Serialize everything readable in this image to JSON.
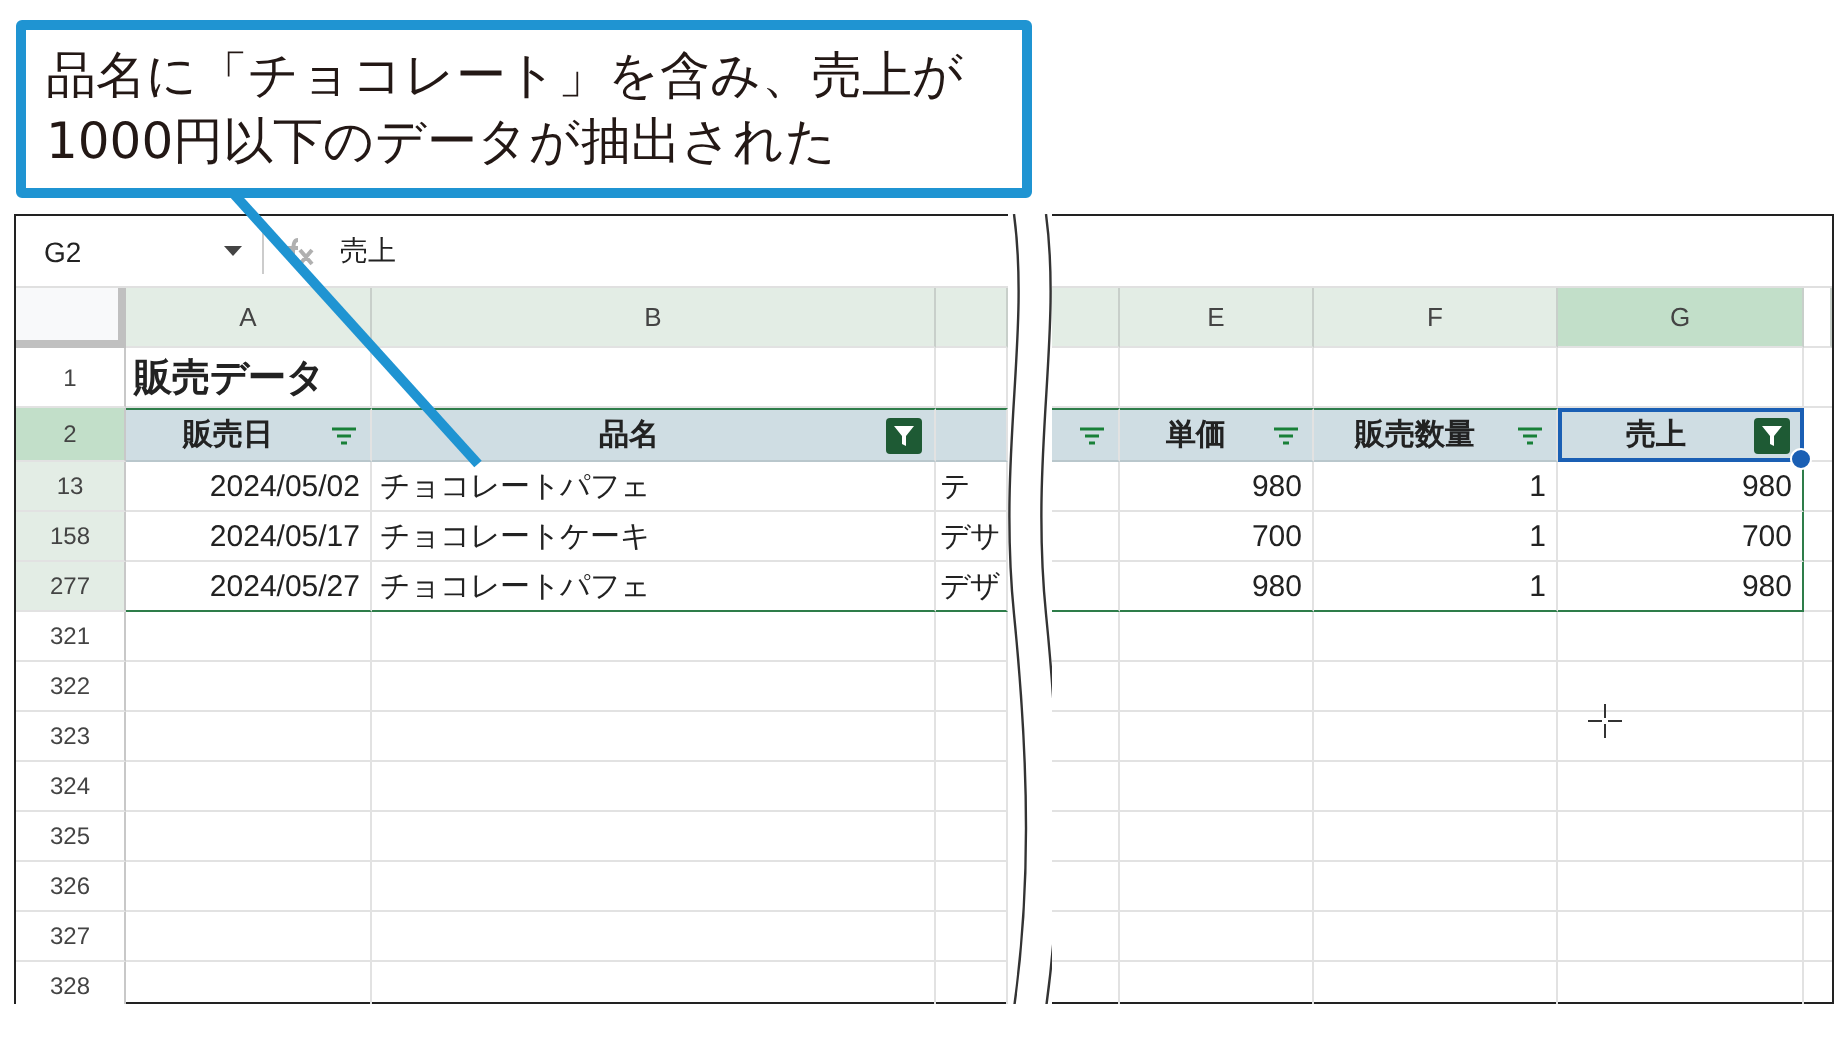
{
  "callout": {
    "lines": [
      "品名に「チョコレート」を含み、売上が",
      "1000円以下のデータが抽出された"
    ]
  },
  "formula_bar": {
    "cell_ref": "G2",
    "formula": "売上"
  },
  "left_columns": [
    {
      "letter": "A",
      "selected": false
    },
    {
      "letter": "B",
      "selected": false
    }
  ],
  "right_columns": [
    {
      "letter": "E",
      "selected": false
    },
    {
      "letter": "F",
      "selected": false
    },
    {
      "letter": "G",
      "selected": true
    }
  ],
  "title_row": {
    "number": "1",
    "title": "販売データ"
  },
  "header_row": {
    "number": "2",
    "selected": true,
    "left_cells": [
      {
        "text": "販売日",
        "filter_active": false
      },
      {
        "text": "品名",
        "filter_active": true
      }
    ],
    "cut_cell": {
      "filter_active": false
    },
    "right_cells": [
      {
        "text": "単価",
        "filter_active": false,
        "selected": false
      },
      {
        "text": "販売数量",
        "filter_active": false,
        "selected": false
      },
      {
        "text": "売上",
        "filter_active": true,
        "selected": true
      }
    ]
  },
  "rows": [
    {
      "number": "13",
      "date": "2024/05/02",
      "name": "チョコレートパフェ",
      "cut": "テ",
      "values": [
        "980",
        "1",
        "980"
      ]
    },
    {
      "number": "158",
      "date": "2024/05/17",
      "name": "チョコレートケーキ",
      "cut": "デサ",
      "values": [
        "700",
        "1",
        "700"
      ]
    },
    {
      "number": "277",
      "date": "2024/05/27",
      "name": "チョコレートパフェ",
      "cut": "デザ",
      "values": [
        "980",
        "1",
        "980"
      ]
    }
  ],
  "empty_rows": [
    "321",
    "322",
    "323",
    "324",
    "325",
    "326",
    "327",
    "328"
  ]
}
